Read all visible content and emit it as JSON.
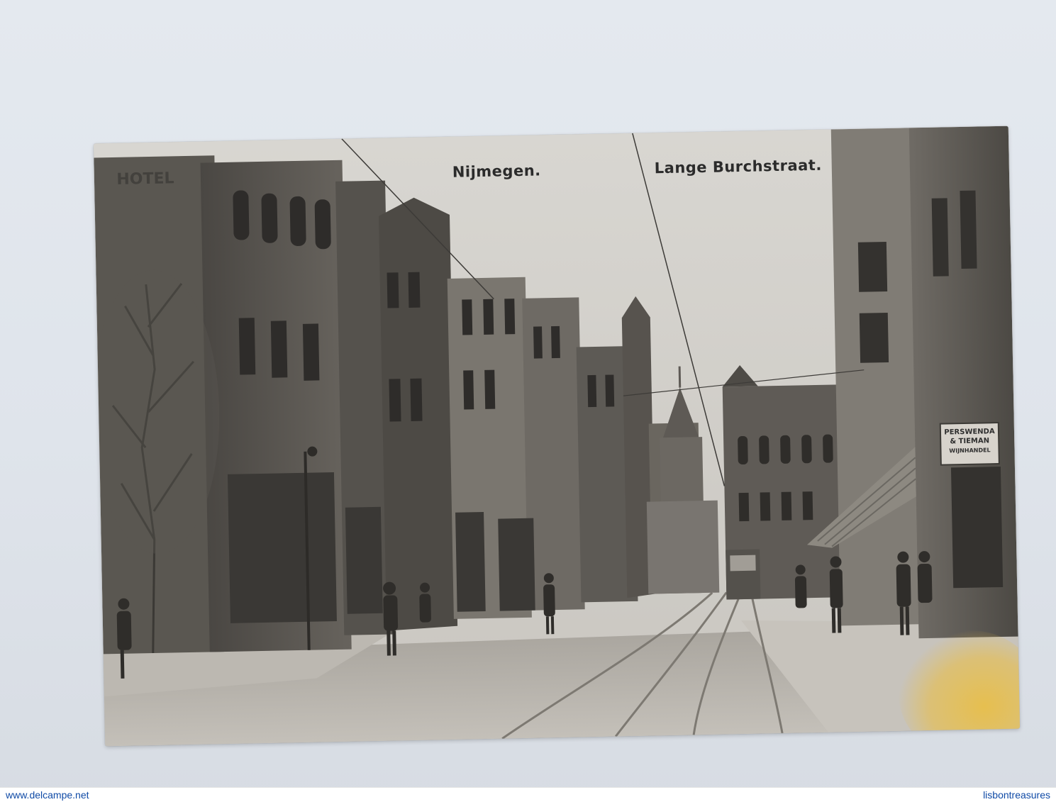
{
  "postcard": {
    "caption_city": "Nijmegen.",
    "caption_street": "Lange Burchstraat.",
    "signs": {
      "shop_name_line1": "PERSWENDA",
      "shop_name_line2": "& TIEMAN",
      "shop_name_line3": "WIJNHANDEL",
      "hotel_sign": "HOTEL"
    }
  },
  "footer": {
    "left_watermark": "www.delcampe.net",
    "right_watermark": "lisbontreasures"
  },
  "colors": {
    "backdrop": "#e0e5ec",
    "sepia_light": "#d9d6cf",
    "sepia_dark": "#3a3835",
    "watermark_blue": "#0f4aa6"
  }
}
